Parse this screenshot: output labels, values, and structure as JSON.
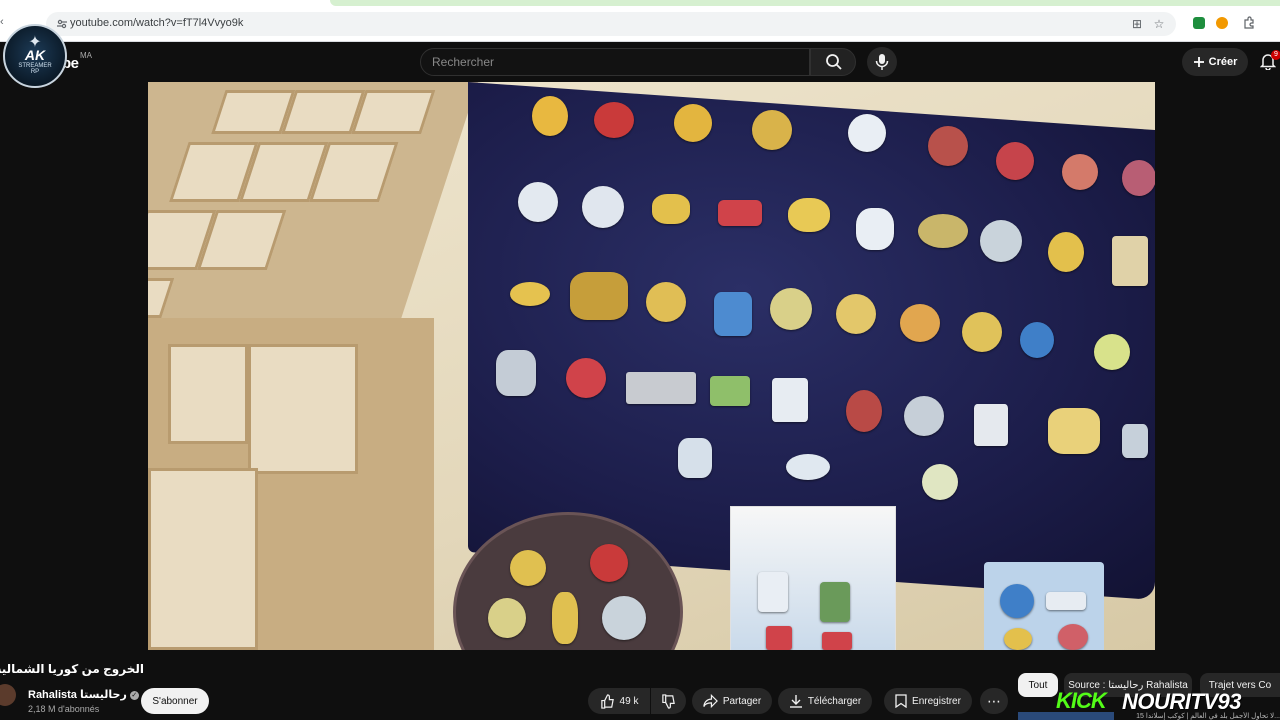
{
  "browser": {
    "url": "youtube.com/watch?v=fT7l4Vvyo9k"
  },
  "youtube": {
    "logo_text": "be",
    "country_code": "MA",
    "search_placeholder": "Rechercher",
    "create_label": "Créer",
    "notification_count": "9"
  },
  "overlay_logo": {
    "initials": "AK",
    "line2": "STREAMER",
    "line3": "RP"
  },
  "video": {
    "title": "الخروج من كوريا الشمالية !! KP",
    "channel_name": "Rahalista رحاليستا",
    "subscribers": "2,18 M d'abonnés",
    "subscribe_label": "S'abonner",
    "likes": "49 k",
    "share_label": "Partager",
    "download_label": "Télécharger",
    "save_label": "Enregistrer"
  },
  "chips": [
    {
      "label": "Tout",
      "active": true
    },
    {
      "label": "Source : رحاليستا Rahalista",
      "active": false
    },
    {
      "label": "Trajet vers Co",
      "active": false
    }
  ],
  "stream_overlay": {
    "brand": "KICK",
    "handle": "NOURITV93"
  },
  "suggestion_caption": "...لا تحاول الأجمل بلد في العالم | كوكب إسلاندا 15",
  "colors": {
    "background": "#0f0f0f",
    "kick_green": "#53fc18",
    "pill": "#272727",
    "notification": "#cc0000"
  }
}
